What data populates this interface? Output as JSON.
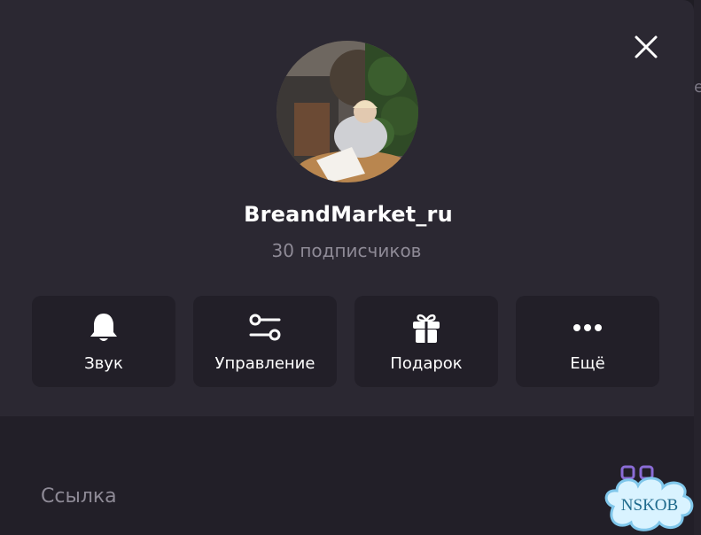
{
  "channel": {
    "name": "BreandMarket_ru",
    "subscribers": "30 подписчиков"
  },
  "actions": [
    {
      "label": "Звук",
      "icon": "bell-icon"
    },
    {
      "label": "Управление",
      "icon": "sliders-icon"
    },
    {
      "label": "Подарок",
      "icon": "gift-icon"
    },
    {
      "label": "Ещё",
      "icon": "more-dots-icon"
    }
  ],
  "info": {
    "link_label": "Ссылка"
  },
  "background": {
    "edge_char": "е"
  },
  "watermark": {
    "text": "NSKOB"
  },
  "colors": {
    "modal_header": "#2b2832",
    "button_bg": "#221f28",
    "text_primary": "#ffffff",
    "text_secondary": "#8e8a96",
    "accent": "#8a6cd6"
  }
}
